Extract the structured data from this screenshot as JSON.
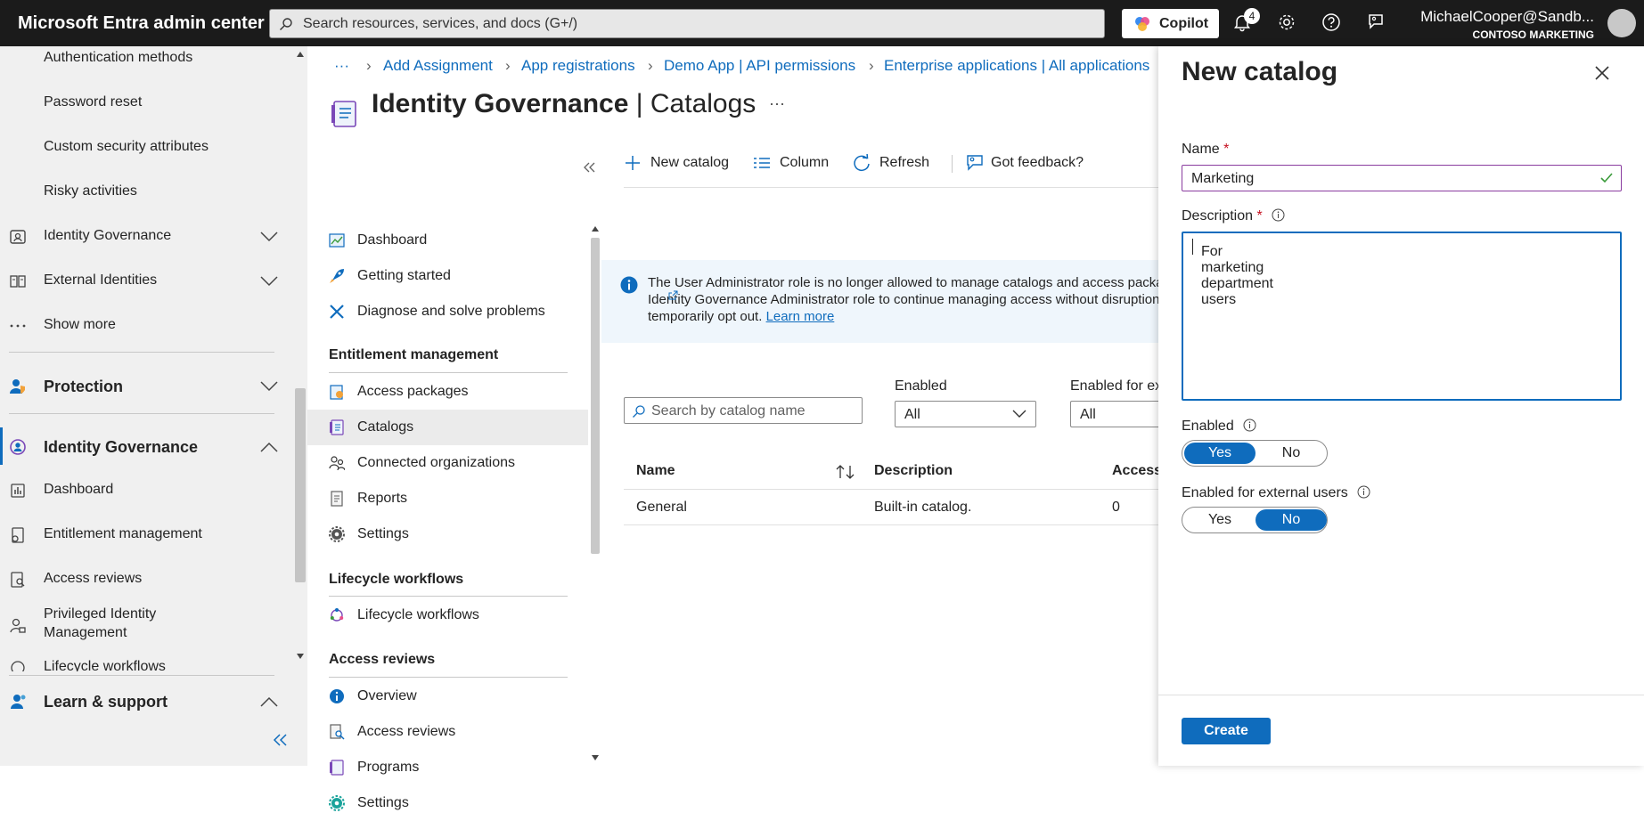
{
  "topbar": {
    "brand": "Microsoft Entra admin center",
    "search_placeholder": "Search resources, services, and docs (G+/)",
    "copilot_label": "Copilot",
    "notification_count": "4",
    "user_name": "MichaelCooper@Sandb...",
    "org_name": "CONTOSO MARKETING"
  },
  "leftnav": {
    "items": [
      {
        "label": "Authentication methods"
      },
      {
        "label": "Password reset"
      },
      {
        "label": "Custom security attributes"
      },
      {
        "label": "Risky activities"
      },
      {
        "label": "Identity Governance"
      },
      {
        "label": "External Identities"
      },
      {
        "label": "Show more"
      },
      {
        "label": "Protection"
      },
      {
        "label": "Identity Governance"
      },
      {
        "label": "Dashboard"
      },
      {
        "label": "Entitlement management"
      },
      {
        "label": "Access reviews"
      },
      {
        "label": "Privileged Identity Management"
      },
      {
        "label": "Lifecycle workflows"
      },
      {
        "label": "Learn & support"
      }
    ]
  },
  "breadcrumb": {
    "more": "···",
    "items": [
      "Add Assignment",
      "App registrations",
      "Demo App | API permissions",
      "Enterprise applications | All applications"
    ]
  },
  "page": {
    "title": "Identity Governance",
    "subtitle": "Catalogs",
    "more": "···"
  },
  "govnav": {
    "items": [
      "Dashboard",
      "Getting started",
      "Diagnose and solve problems"
    ],
    "sections": [
      {
        "title": "Entitlement management",
        "items": [
          "Access packages",
          "Catalogs",
          "Connected organizations",
          "Reports",
          "Settings"
        ]
      },
      {
        "title": "Lifecycle workflows",
        "items": [
          "Lifecycle workflows"
        ]
      },
      {
        "title": "Access reviews",
        "items": [
          "Overview",
          "Access reviews",
          "Programs",
          "Settings"
        ]
      }
    ]
  },
  "toolbar": {
    "new_catalog": "New catalog",
    "column": "Column",
    "refresh": "Refresh",
    "feedback": "Got feedback?"
  },
  "info_banner": {
    "line1": "The User Administrator role is no longer allowed to manage catalogs and access packages",
    "line2": "Identity Governance Administrator role to continue managing access without disruption",
    "line3": "temporarily opt out.",
    "link": "Learn more"
  },
  "filters": {
    "search_placeholder": "Search by catalog name",
    "enabled_label": "Enabled",
    "enabled_value": "All",
    "external_label": "Enabled for ex",
    "external_value": "All"
  },
  "table": {
    "headers": [
      "Name",
      "Description",
      "Access"
    ],
    "rows": [
      [
        "General",
        "Built-in catalog.",
        "0"
      ]
    ]
  },
  "panel": {
    "title": "New catalog",
    "name_label": "Name",
    "name_value": "Marketing",
    "desc_label": "Description",
    "desc_value": "For marketing department users",
    "enabled_label": "Enabled",
    "external_label": "Enabled for external users",
    "yes": "Yes",
    "no": "No",
    "required_mark": "*",
    "create": "Create"
  }
}
